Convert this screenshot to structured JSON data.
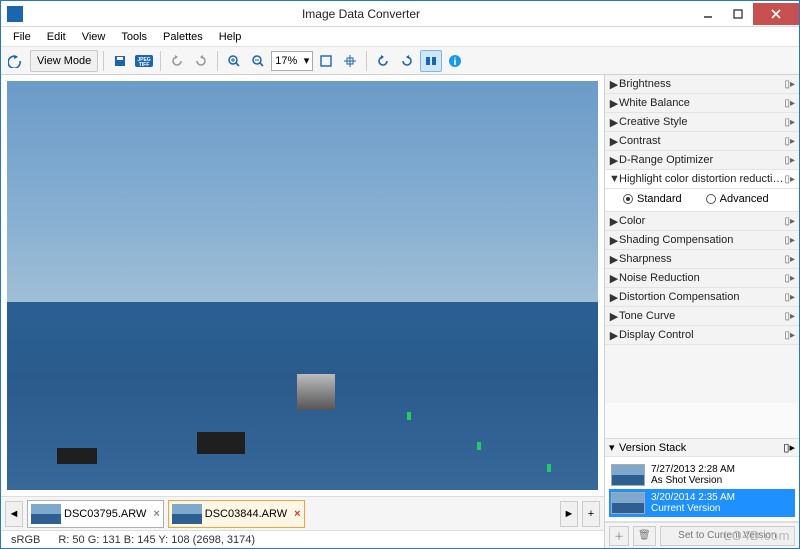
{
  "title": "Image Data Converter",
  "menubar": [
    "File",
    "Edit",
    "View",
    "Tools",
    "Palettes",
    "Help"
  ],
  "toolbar": {
    "viewmode_label": "View Mode",
    "zoom_value": "17%"
  },
  "thumbnails": [
    {
      "name": "DSC03795.ARW",
      "active": false
    },
    {
      "name": "DSC03844.ARW",
      "active": true
    }
  ],
  "status": {
    "colorspace": "sRGB",
    "readout": "R: 50   G: 131   B: 145   Y: 108     (2698, 3174)"
  },
  "panel_groups": [
    {
      "label": "Brightness",
      "expanded": false
    },
    {
      "label": "White Balance",
      "expanded": false
    },
    {
      "label": "Creative Style",
      "expanded": false
    },
    {
      "label": "Contrast",
      "expanded": false
    },
    {
      "label": "D-Range Optimizer",
      "expanded": false
    },
    {
      "label": "Highlight color distortion reduction",
      "expanded": true,
      "options": {
        "a": "Standard",
        "b": "Advanced",
        "selected": "a"
      }
    },
    {
      "label": "Color",
      "expanded": false
    },
    {
      "label": "Shading Compensation",
      "expanded": false
    },
    {
      "label": "Sharpness",
      "expanded": false
    },
    {
      "label": "Noise Reduction",
      "expanded": false
    },
    {
      "label": "Distortion Compensation",
      "expanded": false
    },
    {
      "label": "Tone Curve",
      "expanded": false
    },
    {
      "label": "Display Control",
      "expanded": false
    }
  ],
  "version_stack": {
    "title": "Version Stack",
    "rows": [
      {
        "time": "7/27/2013 2:28 AM",
        "label": "As Shot Version",
        "selected": false
      },
      {
        "time": "3/20/2014 2:35 AM",
        "label": "Current Version",
        "selected": true
      }
    ],
    "set_label": "Set to Current Version"
  },
  "watermark": "LO4D.com"
}
